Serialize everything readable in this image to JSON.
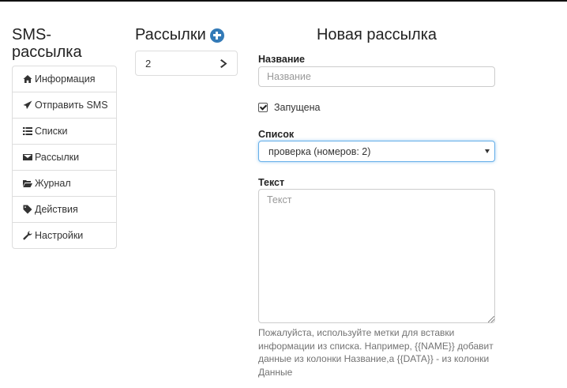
{
  "brand": "SMS-рассылка",
  "nav": {
    "items": [
      {
        "label": "Информация",
        "icon": "home-icon"
      },
      {
        "label": "Отправить SMS",
        "icon": "send-icon"
      },
      {
        "label": "Списки",
        "icon": "list-icon"
      },
      {
        "label": "Рассылки",
        "icon": "envelope-icon"
      },
      {
        "label": "Журнал",
        "icon": "folder-open-icon"
      },
      {
        "label": "Действия",
        "icon": "tag-icon"
      },
      {
        "label": "Настройки",
        "icon": "wrench-icon"
      }
    ]
  },
  "campaigns": {
    "title": "Рассылки",
    "items": [
      {
        "label": "2"
      }
    ]
  },
  "form": {
    "title": "Новая рассылка",
    "name_label": "Название",
    "name_placeholder": "Название",
    "name_value": "",
    "running_label": "Запущена",
    "running_checked": true,
    "list_label": "Список",
    "list_value": "проверка (номеров: 2)",
    "text_label": "Текст",
    "text_placeholder": "Текст",
    "help": "Пожалуйста, используйте метки для вставки информации из списка. Например, {{NAME}} добавит данные из колонки Название,а {{DATA}} - из колонки Данные"
  },
  "colors": {
    "accent": "#337ab7",
    "focus_border": "#66afe9",
    "help_text": "#737373"
  }
}
